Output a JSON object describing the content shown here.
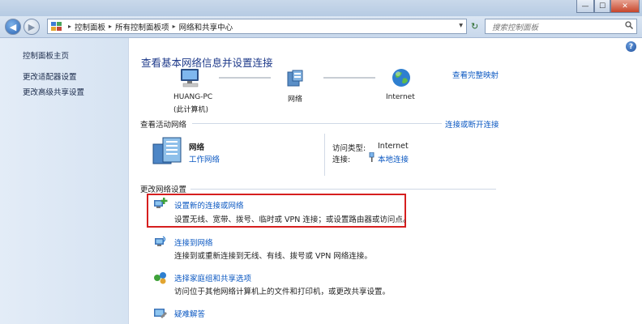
{
  "window": {
    "caption_buttons": [
      "minimize",
      "maximize",
      "close"
    ],
    "close_symbol": "✕",
    "minimize_symbol": "—",
    "maximize_symbol": "☐"
  },
  "address": {
    "back_symbol": "◀",
    "forward_symbol": "▶",
    "dropdown_symbol": "▾",
    "crumbs": [
      "控制面板",
      "所有控制面板项",
      "网络和共享中心"
    ],
    "search_placeholder": "搜索控制面板",
    "refresh_symbol": "↻"
  },
  "sidebar": {
    "items": [
      "控制面板主页",
      "更改适配器设置",
      "更改高级共享设置"
    ]
  },
  "main": {
    "title": "查看基本网络信息并设置连接",
    "full_map_link": "查看完整映射",
    "help_symbol": "?",
    "map_nodes": {
      "computer_name": "HUANG-PC",
      "computer_sub": "(此计算机)",
      "network": "网络",
      "internet": "Internet"
    },
    "active_section": {
      "title": "查看活动网络",
      "connect_link": "连接或断开连接",
      "network_name": "网络",
      "network_type": "工作网络",
      "access_type_label": "访问类型:",
      "access_type_value": "Internet",
      "connection_label": "连接:",
      "connection_value": "本地连接"
    },
    "settings_section": {
      "title": "更改网络设置",
      "tasks": [
        {
          "title": "设置新的连接或网络",
          "desc": "设置无线、宽带、拨号、临时或 VPN 连接；或设置路由器或访问点。"
        },
        {
          "title": "连接到网络",
          "desc": "连接到或重新连接到无线、有线、拨号或 VPN 网络连接。"
        },
        {
          "title": "选择家庭组和共享选项",
          "desc": "访问位于其他网络计算机上的文件和打印机，或更改共享设置。"
        },
        {
          "title": "疑难解答",
          "desc": ""
        }
      ]
    }
  },
  "colors": {
    "link": "#0b58c2",
    "title": "#1e3a8a",
    "highlight_border": "#d61f1f",
    "sidebar_bg": "#dce7f4"
  },
  "icons": [
    "back-icon",
    "forward-icon",
    "control-panel-icon",
    "refresh-icon",
    "search-icon",
    "help-icon",
    "computer-icon",
    "network-icon",
    "globe-icon",
    "building-network-icon",
    "plug-icon",
    "new-connection-icon",
    "connect-network-icon",
    "homegroup-icon",
    "troubleshoot-icon"
  ]
}
